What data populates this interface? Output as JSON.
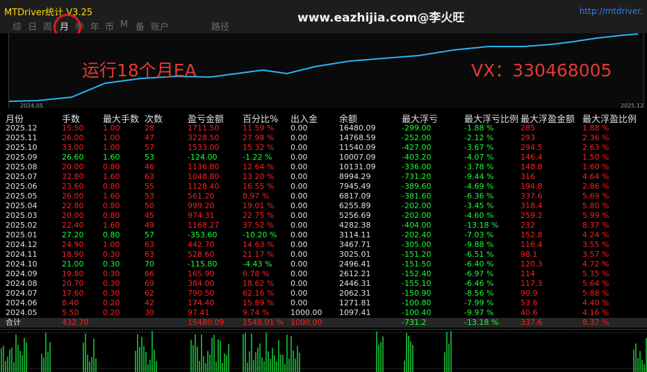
{
  "app": {
    "title": "MTDriver统计  V3.25",
    "watermark": "www.eazhijia.com@李火旺",
    "url": "http://mtdriver."
  },
  "tabs": [
    {
      "label": "综"
    },
    {
      "label": "日"
    },
    {
      "label": "周"
    },
    {
      "label": "月"
    },
    {
      "label": "季"
    },
    {
      "label": "年"
    },
    {
      "label": "币"
    },
    {
      "label": "M"
    },
    {
      "label": "备"
    },
    {
      "label": "账户"
    },
    {
      "label": "路径"
    }
  ],
  "active_tab": "月",
  "chart": {
    "date_start": "2024.05",
    "date_end": "2025.12",
    "color": "#29b6f6"
  },
  "overlay": {
    "left_text": "运行18个月EA",
    "right_text": "VX：330468005"
  },
  "table": {
    "headers": [
      "月份",
      "手数",
      "最大手数",
      "次数",
      "盈亏金额",
      "百分比%",
      "出入金",
      "余额",
      "最大浮亏",
      "最大浮亏比例",
      "最大浮盈金额",
      "最大浮盈比例"
    ],
    "rows": [
      {
        "month": "2025.12",
        "lots": "15.50",
        "max_lots": "1.00",
        "count": "28",
        "pnl": "1711.50",
        "pct": "11.59 %",
        "io": "0.00",
        "balance": "16480.09",
        "max_dd": "-299.00",
        "dd_pct": "-1.88 %",
        "max_fp": "285",
        "fp_pct": "1.88 %",
        "sign": "pos"
      },
      {
        "month": "2025.11",
        "lots": "26.00",
        "max_lots": "1.00",
        "count": "47",
        "pnl": "3228.50",
        "pct": "27.98 %",
        "io": "0.00",
        "balance": "14768.59",
        "max_dd": "-252.00",
        "dd_pct": "-2.12 %",
        "max_fp": "293",
        "fp_pct": "2.36 %",
        "sign": "pos"
      },
      {
        "month": "2025.10",
        "lots": "33.00",
        "max_lots": "1.00",
        "count": "57",
        "pnl": "1533.00",
        "pct": "15.32 %",
        "io": "0.00",
        "balance": "11540.09",
        "max_dd": "-427.00",
        "dd_pct": "-3.67 %",
        "max_fp": "294.5",
        "fp_pct": "2.63 %",
        "sign": "pos"
      },
      {
        "month": "2025.09",
        "lots": "26.60",
        "max_lots": "1.60",
        "count": "53",
        "pnl": "-124.00",
        "pct": "-1.22 %",
        "io": "0.00",
        "balance": "10007.09",
        "max_dd": "-403.20",
        "dd_pct": "-4.07 %",
        "max_fp": "146.4",
        "fp_pct": "1.50 %",
        "sign": "neg"
      },
      {
        "month": "2025.08",
        "lots": "20.00",
        "max_lots": "0.80",
        "count": "46",
        "pnl": "1136.80",
        "pct": "12.64 %",
        "io": "0.00",
        "balance": "10131.09",
        "max_dd": "-336.00",
        "dd_pct": "-3.78 %",
        "max_fp": "148.8",
        "fp_pct": "1.60 %",
        "sign": "pos"
      },
      {
        "month": "2025.07",
        "lots": "32.80",
        "max_lots": "1.60",
        "count": "63",
        "pnl": "1048.80",
        "pct": "13.20 %",
        "io": "0.00",
        "balance": "8994.29",
        "max_dd": "-731.20",
        "dd_pct": "-9.44 %",
        "max_fp": "316",
        "fp_pct": "4.64 %",
        "sign": "pos"
      },
      {
        "month": "2025.06",
        "lots": "23.60",
        "max_lots": "0.80",
        "count": "55",
        "pnl": "1128.40",
        "pct": "16.55 %",
        "io": "0.00",
        "balance": "7945.49",
        "max_dd": "-389.60",
        "dd_pct": "-4.69 %",
        "max_fp": "194.8",
        "fp_pct": "2.86 %",
        "sign": "pos"
      },
      {
        "month": "2025.05",
        "lots": "26.00",
        "max_lots": "1.60",
        "count": "53",
        "pnl": "561.20",
        "pct": "8.97 %",
        "io": "0.00",
        "balance": "6817.09",
        "max_dd": "-381.60",
        "dd_pct": "-6.36 %",
        "max_fp": "337.6",
        "fp_pct": "5.69 %",
        "sign": "pos"
      },
      {
        "month": "2025.04",
        "lots": "22.80",
        "max_lots": "0.80",
        "count": "50",
        "pnl": "999.20",
        "pct": "19.01 %",
        "io": "0.00",
        "balance": "6255.89",
        "max_dd": "-202.00",
        "dd_pct": "-3.45 %",
        "max_fp": "318.4",
        "fp_pct": "5.80 %",
        "sign": "pos"
      },
      {
        "month": "2025.03",
        "lots": "20.00",
        "max_lots": "0.80",
        "count": "45",
        "pnl": "974.31",
        "pct": "22.75 %",
        "io": "0.00",
        "balance": "5256.69",
        "max_dd": "-202.00",
        "dd_pct": "-4.60 %",
        "max_fp": "259.2",
        "fp_pct": "5.99 %",
        "sign": "pos"
      },
      {
        "month": "2025.02",
        "lots": "22.40",
        "max_lots": "1.60",
        "count": "49",
        "pnl": "1168.27",
        "pct": "37.52 %",
        "io": "0.00",
        "balance": "4282.38",
        "max_dd": "-404.00",
        "dd_pct": "-13.18 %",
        "max_fp": "232",
        "fp_pct": "8.37 %",
        "sign": "pos"
      },
      {
        "month": "2025.01",
        "lots": "27.20",
        "max_lots": "0.80",
        "count": "57",
        "pnl": "-353.60",
        "pct": "-10.20 %",
        "io": "0.00",
        "balance": "3114.11",
        "max_dd": "-202.40",
        "dd_pct": "-7.03 %",
        "max_fp": "152.8",
        "fp_pct": "4.24 %",
        "sign": "neg"
      },
      {
        "month": "2024.12",
        "lots": "24.90",
        "max_lots": "1.00",
        "count": "63",
        "pnl": "442.70",
        "pct": "14.63 %",
        "io": "0.00",
        "balance": "3467.71",
        "max_dd": "-305.00",
        "dd_pct": "-9.88 %",
        "max_fp": "116.4",
        "fp_pct": "3.55 %",
        "sign": "pos"
      },
      {
        "month": "2024.11",
        "lots": "18.90",
        "max_lots": "0.30",
        "count": "63",
        "pnl": "528.60",
        "pct": "21.17 %",
        "io": "0.00",
        "balance": "3025.01",
        "max_dd": "-151.20",
        "dd_pct": "-6.51 %",
        "max_fp": "98.1",
        "fp_pct": "3.57 %",
        "sign": "pos"
      },
      {
        "month": "2024.10",
        "lots": "21.00",
        "max_lots": "0.30",
        "count": "70",
        "pnl": "-115.80",
        "pct": "-4.43 %",
        "io": "0.00",
        "balance": "2496.41",
        "max_dd": "-151.50",
        "dd_pct": "-6.40 %",
        "max_fp": "120.3",
        "fp_pct": "4.72 %",
        "sign": "neg"
      },
      {
        "month": "2024.09",
        "lots": "19.80",
        "max_lots": "0.30",
        "count": "66",
        "pnl": "165.90",
        "pct": "6.78 %",
        "io": "0.00",
        "balance": "2612.21",
        "max_dd": "-152.40",
        "dd_pct": "-6.97 %",
        "max_fp": "114",
        "fp_pct": "5.35 %",
        "sign": "pos"
      },
      {
        "month": "2024.08",
        "lots": "20.70",
        "max_lots": "0.30",
        "count": "69",
        "pnl": "384.00",
        "pct": "18.62 %",
        "io": "0.00",
        "balance": "2446.31",
        "max_dd": "-155.10",
        "dd_pct": "-6.46 %",
        "max_fp": "117.3",
        "fp_pct": "5.64 %",
        "sign": "pos"
      },
      {
        "month": "2024.07",
        "lots": "17.60",
        "max_lots": "0.30",
        "count": "62",
        "pnl": "790.50",
        "pct": "62.16 %",
        "io": "0.00",
        "balance": "2062.31",
        "max_dd": "-150.90",
        "dd_pct": "-8.56 %",
        "max_fp": "90.9",
        "fp_pct": "5.88 %",
        "sign": "pos"
      },
      {
        "month": "2024.06",
        "lots": "8.40",
        "max_lots": "0.20",
        "count": "42",
        "pnl": "174.40",
        "pct": "15.89 %",
        "io": "0.00",
        "balance": "1271.81",
        "max_dd": "-100.80",
        "dd_pct": "-7.99 %",
        "max_fp": "53.6",
        "fp_pct": "4.40 %",
        "sign": "pos"
      },
      {
        "month": "2024.05",
        "lots": "5.50",
        "max_lots": "0.20",
        "count": "30",
        "pnl": "97.41",
        "pct": "9.74 %",
        "io": "1000.00",
        "balance": "1097.41",
        "max_dd": "-100.40",
        "dd_pct": "-9.97 %",
        "max_fp": "40.6",
        "fp_pct": "4.16 %",
        "sign": "pos"
      }
    ],
    "total": {
      "label": "合计",
      "lots": "432.70",
      "pnl": "15480.09",
      "pct": "1548.01 %",
      "io": "1000.00",
      "max_dd": "-731.2",
      "dd_pct": "-13.18 %",
      "max_fp": "337.6",
      "fp_pct": "8.37 %"
    }
  }
}
